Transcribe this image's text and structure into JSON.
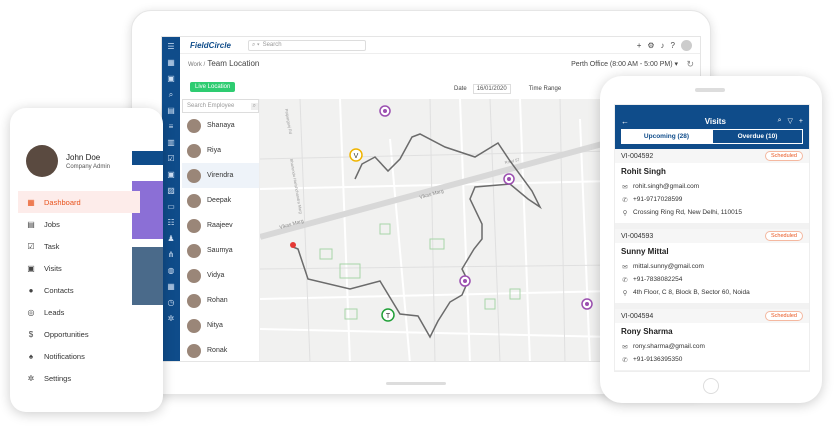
{
  "tablet": {
    "brand": "FieldCircle",
    "search_placeholder": "Search",
    "breadcrumb_root": "Work /",
    "breadcrumb_current": "Team Location",
    "office": "Perth Office (8:00 AM - 5:00 PM) ▾",
    "live_button": "Live Location",
    "date_label": "Date",
    "date_value": "16/01/2020",
    "time_range_label": "Time Range",
    "employee_search_placeholder": "Search Employee",
    "employees": [
      {
        "name": "Shanaya"
      },
      {
        "name": "Riya"
      },
      {
        "name": "Virendra"
      },
      {
        "name": "Deepak"
      },
      {
        "name": "Raajeev"
      },
      {
        "name": "Saumya"
      },
      {
        "name": "Vidya"
      },
      {
        "name": "Rohan"
      },
      {
        "name": "Nitya"
      },
      {
        "name": "Ronak"
      }
    ],
    "map_labels": {
      "road1": "Vikas Marg",
      "road2": "Vikas Marg",
      "road3": "Bhartendu Harishchandra Marg",
      "road4": "Patparganj Rd",
      "road5": "Road 57",
      "marker_v": "V",
      "marker_t": "T"
    }
  },
  "phone_left": {
    "user_name": "John Doe",
    "user_role": "Company Admin",
    "menu": [
      {
        "label": "Dashboard",
        "icon": "dashboard-icon",
        "glyph": "▦",
        "active": true
      },
      {
        "label": "Jobs",
        "icon": "briefcase-icon",
        "glyph": "▤",
        "active": false
      },
      {
        "label": "Task",
        "icon": "checkbox-icon",
        "glyph": "☑",
        "active": false
      },
      {
        "label": "Visits",
        "icon": "calendar-icon",
        "glyph": "▣",
        "active": false
      },
      {
        "label": "Contacts",
        "icon": "person-icon",
        "glyph": "●",
        "active": false
      },
      {
        "label": "Leads",
        "icon": "target-icon",
        "glyph": "◎",
        "active": false
      },
      {
        "label": "Opportunities",
        "icon": "dollar-icon",
        "glyph": "$",
        "active": false
      },
      {
        "label": "Notifications",
        "icon": "bell-icon",
        "glyph": "♠",
        "active": false
      },
      {
        "label": "Settings",
        "icon": "gear-icon",
        "glyph": "✲",
        "active": false
      }
    ]
  },
  "phone_right": {
    "title": "Visits",
    "tabs": [
      {
        "label": "Upcoming (28)",
        "active": true
      },
      {
        "label": "Overdue (10)",
        "active": false
      }
    ],
    "visits": [
      {
        "id": "VI-004592",
        "status": "Scheduled",
        "name": "Rohit Singh",
        "email": "rohit.singh@gmail.com",
        "phone": "+91-9717028599",
        "address": "Crossing Ring Rd, New Delhi, 110015"
      },
      {
        "id": "VI-004593",
        "status": "Scheduled",
        "name": "Sunny Mittal",
        "email": "mittal.sunny@gmail.com",
        "phone": "+91-7838082254",
        "address": "4th Floor, C 8, Block B, Sector 60, Noida"
      },
      {
        "id": "VI-004594",
        "status": "Scheduled",
        "name": "Rony Sharma",
        "email": "rony.sharma@gmail.com",
        "phone": "+91-9136395350"
      }
    ]
  },
  "colors": {
    "brand_blue": "#0f4c8a",
    "accent_orange": "#e8541e",
    "live_green": "#2ecc71",
    "marker_purple": "#9b4fb0"
  }
}
